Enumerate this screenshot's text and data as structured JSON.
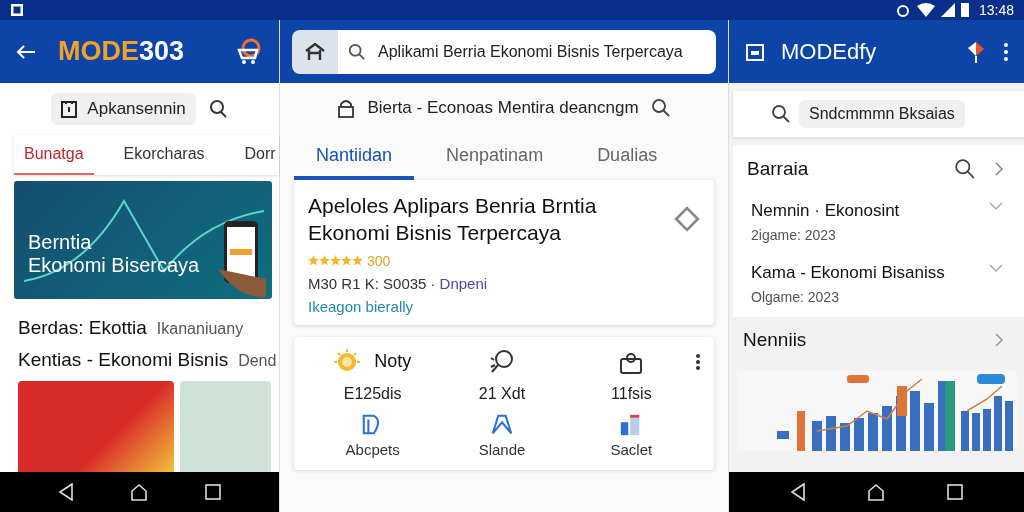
{
  "status_bar": {
    "time": "13:48"
  },
  "left": {
    "logo": {
      "accent": "MODE",
      "rest": "303"
    },
    "search_chip": {
      "label": "Apkansennin"
    },
    "tabs": [
      {
        "label": "Bunatga",
        "selected": true
      },
      {
        "label": "Ekorcharas",
        "selected": false
      },
      {
        "label": "Dorr",
        "selected": false
      }
    ],
    "banner": {
      "title": "Berntia",
      "subtitle": "Ekonomi Bisercaya"
    },
    "headlines": [
      {
        "title": "Berdas: Ekottia",
        "source": "Ikananiuany"
      },
      {
        "title": "Kentias - Ekonomi Bisnis",
        "source": "Dend"
      }
    ]
  },
  "center": {
    "search": {
      "value": "Aplikami Berria Ekonomi Bisnis Terpercaya"
    },
    "subtitle": "Bierta - Econoas Mentira deancngm",
    "tabs": [
      {
        "label": "Nantiidan",
        "selected": true
      },
      {
        "label": "Nenpatinam",
        "selected": false
      },
      {
        "label": "Dualias",
        "selected": false
      }
    ],
    "app_card": {
      "title": "Apeloles Aplipars Benria Brntia Ekonomi Bisnis Terpercaya",
      "stars": 5,
      "rating": "300",
      "meta": "M30 R1 K: S0035 ·",
      "developer": "Dnpeni",
      "category": "Ikeagon bierally"
    },
    "stats": {
      "heading": "Noty",
      "values": [
        "E125dis",
        "21 Xdt",
        "11fsis"
      ],
      "actions": [
        {
          "kind": "doc",
          "label": "Abcpets"
        },
        {
          "kind": "map",
          "label": "Slande"
        },
        {
          "kind": "bars",
          "label": "Saclet"
        }
      ]
    }
  },
  "right": {
    "title": "MODEdfy",
    "search_chip": {
      "label": "Sndcmmmn Bksaias"
    },
    "section": {
      "title": "Barraia",
      "items": [
        {
          "title": "Nemnin · Ekonosint",
          "subtitle": "2igame: 2023",
          "expanded": false
        },
        {
          "title": "Kama - Ekonomi Bisaniss",
          "subtitle": "Olgame: 2023",
          "expanded": false
        }
      ]
    },
    "section_2": {
      "title": "Nenniis"
    }
  }
}
